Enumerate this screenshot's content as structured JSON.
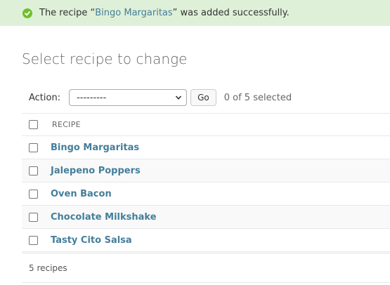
{
  "message": {
    "prefix": "The recipe “",
    "link": "Bingo Margaritas",
    "suffix": "” was added successfully.",
    "icon": "check-circle-icon",
    "color": "#70bf2b"
  },
  "page_title": "Select recipe to change",
  "actions": {
    "label": "Action:",
    "selected_option": "---------",
    "go_label": "Go",
    "selection_count": "0 of 5 selected"
  },
  "table": {
    "header": "RECIPE",
    "rows": [
      {
        "name": "Bingo Margaritas"
      },
      {
        "name": "Jalepeno Poppers"
      },
      {
        "name": "Oven Bacon"
      },
      {
        "name": "Chocolate Milkshake"
      },
      {
        "name": "Tasty Cito Salsa"
      }
    ]
  },
  "footer": {
    "count": "5 recipes"
  },
  "colors": {
    "link": "#447e9b",
    "success_bg": "#dff0d8"
  }
}
